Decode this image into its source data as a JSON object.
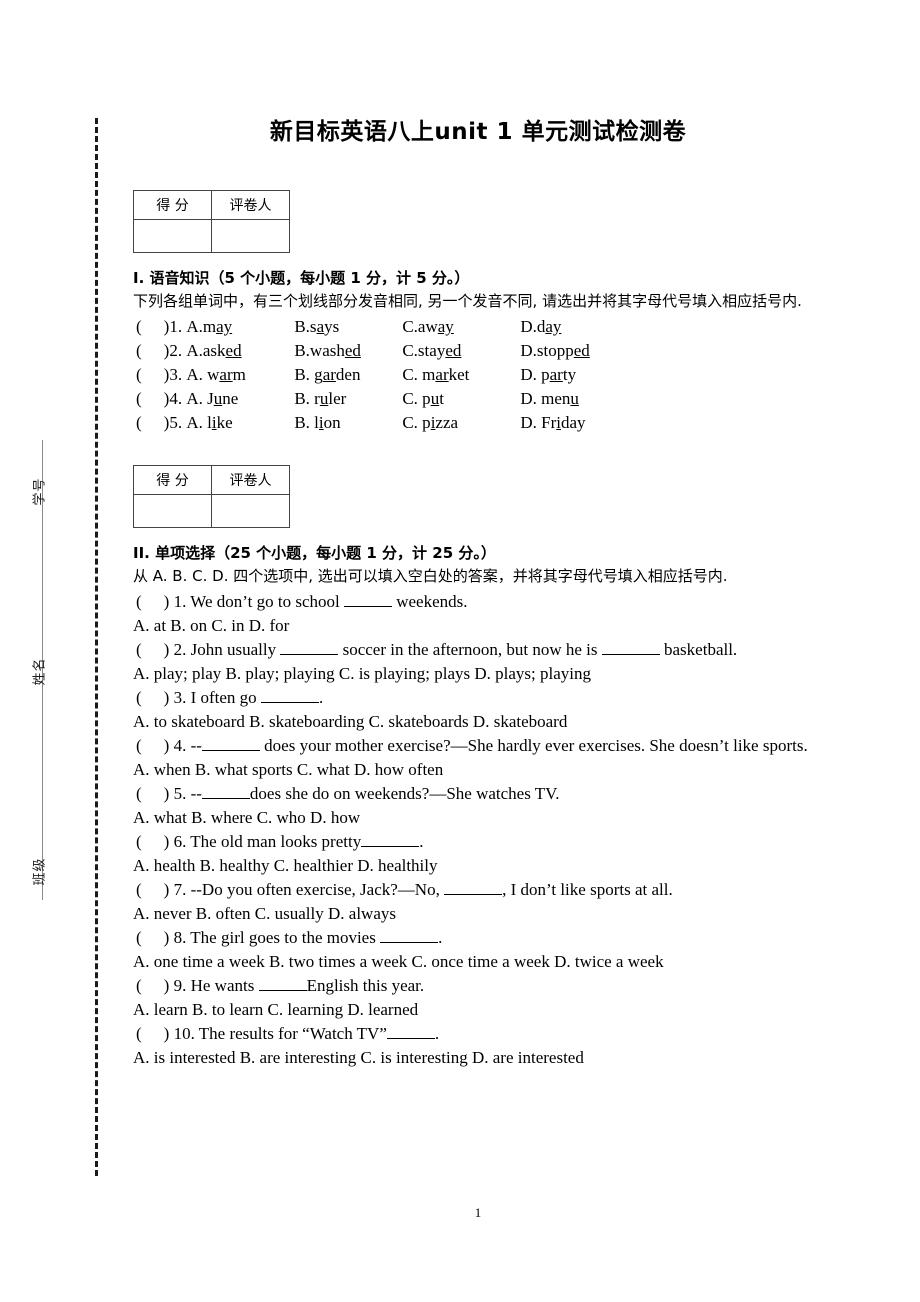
{
  "document": {
    "title": "新目标英语八上unit 1 单元测试检测卷",
    "page_number": "1"
  },
  "margin": {
    "labels": {
      "student_id": "学号",
      "name": "姓名",
      "class": "班级"
    }
  },
  "score_box": {
    "score_label": "得 分",
    "grader_label": "评卷人",
    "score_value": "",
    "grader_value": ""
  },
  "sections": [
    {
      "id": "phonetics",
      "heading": "I. 语音知识（5 个小题，每小题 1 分，计 5 分。）",
      "instruction": "下列各组单词中，有三个划线部分发音相同, 另一个发音不同, 请选出并将其字母代号填入相应括号内.",
      "questions": [
        {
          "number": "1.",
          "a_pre": "A.m",
          "a_u": "ay",
          "a_post": "",
          "b_pre": "B.s",
          "b_u": "a",
          "b_post": "ys",
          "c_pre": "C.aw",
          "c_u": "ay",
          "c_post": "",
          "d_pre": "D.d",
          "d_u": "ay",
          "d_post": ""
        },
        {
          "number": "2.",
          "a_pre": "A.ask",
          "a_u": "ed",
          "a_post": "",
          "b_pre": "B.wash",
          "b_u": "ed",
          "b_post": "",
          "c_pre": "C.stay",
          "c_u": "ed",
          "c_post": "",
          "d_pre": "D.stopp",
          "d_u": "ed",
          "d_post": ""
        },
        {
          "number": "3.",
          "a_pre": "A. w",
          "a_u": "ar",
          "a_post": "m",
          "b_pre": "B. g",
          "b_u": "ar",
          "b_post": "den",
          "c_pre": "C. m",
          "c_u": "ar",
          "c_post": "ket",
          "d_pre": "D. p",
          "d_u": "ar",
          "d_post": "ty"
        },
        {
          "number": "4.",
          "a_pre": "A. J",
          "a_u": "u",
          "a_post": "ne",
          "b_pre": "B. r",
          "b_u": "u",
          "b_post": "ler",
          "c_pre": "C. p",
          "c_u": "u",
          "c_post": "t",
          "d_pre": "D. men",
          "d_u": "u",
          "d_post": ""
        },
        {
          "number": "5.",
          "a_pre": "A. l",
          "a_u": "i",
          "a_post": "ke",
          "b_pre": "B. l",
          "b_u": "i",
          "b_post": "on",
          "c_pre": "C. p",
          "c_u": "i",
          "c_post": "zza",
          "d_pre": "D. Fr",
          "d_u": "i",
          "d_post": "day"
        }
      ]
    },
    {
      "id": "multiple-choice",
      "heading": "II. 单项选择（25 个小题，每小题 1 分，计 25 分。）",
      "instruction": "从 A. B. C. D. 四个选项中, 选出可以填入空白处的答案，并将其字母代号填入相应括号内.",
      "questions": [
        {
          "number": "1.",
          "stem_pre": "We don’t go to school ",
          "stem_post": " weekends.",
          "options": "A. at       B. on     C. in     D. for"
        },
        {
          "number": "2.",
          "stem_pre": "John usually ",
          "stem_mid": " soccer in the afternoon, but now he is ",
          "stem_post": " basketball.",
          "options": "A. play; play     B. play; playing    C. is playing; plays    D. plays; playing"
        },
        {
          "number": "3.",
          "stem_pre": "I often go ",
          "stem_post": ".",
          "options": "A. to skateboard     B. skateboarding     C. skateboards   D. skateboard"
        },
        {
          "number": "4.",
          "stem_pre": "--",
          "stem_post": " does your mother exercise?—She hardly ever exercises. She doesn’t like sports.",
          "options": "A. when     B. what sports     C. what     D. how often"
        },
        {
          "number": "5.",
          "stem_pre": "--",
          "stem_post": "does she do on weekends?—She watches TV.",
          "options": "A. what     B. where     C. who     D. how"
        },
        {
          "number": "6.",
          "stem_pre": "The old man looks pretty",
          "stem_post": ".",
          "options": "A. health     B. healthy     C. healthier     D. healthily"
        },
        {
          "number": "7.",
          "stem_pre": "--Do you often exercise, Jack?—No, ",
          "stem_post": ", I don’t like sports at all.",
          "options": "A. never     B. often     C. usually     D. always"
        },
        {
          "number": "8.",
          "stem_pre": "The girl goes to the movies ",
          "stem_post": ".",
          "options": "A. one time a week      B. two times a week    C. once time a week      D. twice a week"
        },
        {
          "number": "9.",
          "stem_pre": "He wants ",
          "stem_post": "English this year.",
          "options": "A. learn     B. to learn     C. learning     D. learned"
        },
        {
          "number": "10.",
          "stem_pre": "The results for “Watch TV”",
          "stem_post": ".",
          "options": "A. is interested     B. are interesting      C. is interesting   D. are interested"
        }
      ]
    }
  ]
}
